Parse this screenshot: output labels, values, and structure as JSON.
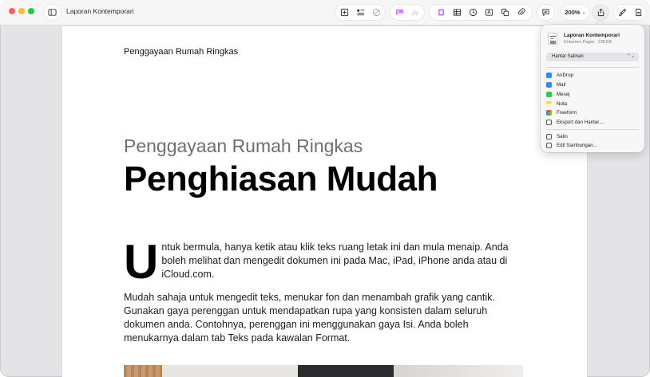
{
  "window": {
    "title": "Laporan Kontemporari"
  },
  "toolbar": {
    "zoom_label": "200%",
    "icons": [
      "sidebar-icon",
      "insert-icon",
      "table-of-contents-icon",
      "shapes-icon",
      "media-icon",
      "chart-icon",
      "text-box-icon",
      "table-icon",
      "clock-icon",
      "textbox-icon",
      "copy-icon",
      "attach-icon",
      "comment-icon",
      "share-icon",
      "format-brush-icon",
      "document-icon"
    ]
  },
  "page": {
    "header": "Penggayaan Rumah Ringkas",
    "subtitle": "Penggayaan Rumah Ringkas",
    "title": "Penghiasan Mudah",
    "drop_cap": "U",
    "paragraph1": "ntuk bermula, hanya ketik atau klik teks ruang letak ini dan mula menaip. Anda boleh melihat dan mengedit dokumen ini pada Mac, iPad, iPhone anda atau di iCloud.com.",
    "paragraph2": "Mudah sahaja untuk mengedit teks, menukar fon dan menambah grafik yang cantik. Gunakan gaya perenggan untuk mendapatkan rupa yang konsisten dalam seluruh dokumen anda. Contohnya, perenggan ini menggunakan gaya Isi. Anda boleh menukarnya dalam tab Teks pada kawalan Format."
  },
  "share_popover": {
    "file_name": "Laporan Kontemporari",
    "file_meta": "Dokumen Pages · 238 KB",
    "send_option": "Hantar Salinan",
    "items": [
      {
        "label": "AirDrop",
        "icon": "airdrop-icon"
      },
      {
        "label": "Mail",
        "icon": "mail-icon"
      },
      {
        "label": "Mesej",
        "icon": "messages-icon"
      },
      {
        "label": "Nota",
        "icon": "notes-icon"
      },
      {
        "label": "Freeform",
        "icon": "freeform-icon"
      },
      {
        "label": "Eksport dan Hantar…",
        "icon": "export-icon"
      }
    ],
    "items2": [
      {
        "label": "Salin",
        "icon": "copy-link-icon"
      },
      {
        "label": "Edit Sambungan…",
        "icon": "edit-extensions-icon"
      }
    ]
  },
  "colors": {
    "window_bg": "#e4e4e7",
    "toolbar_bg": "#f6f6f7",
    "subtitle": "#6e6e73",
    "media_accent": "#c77dff"
  }
}
